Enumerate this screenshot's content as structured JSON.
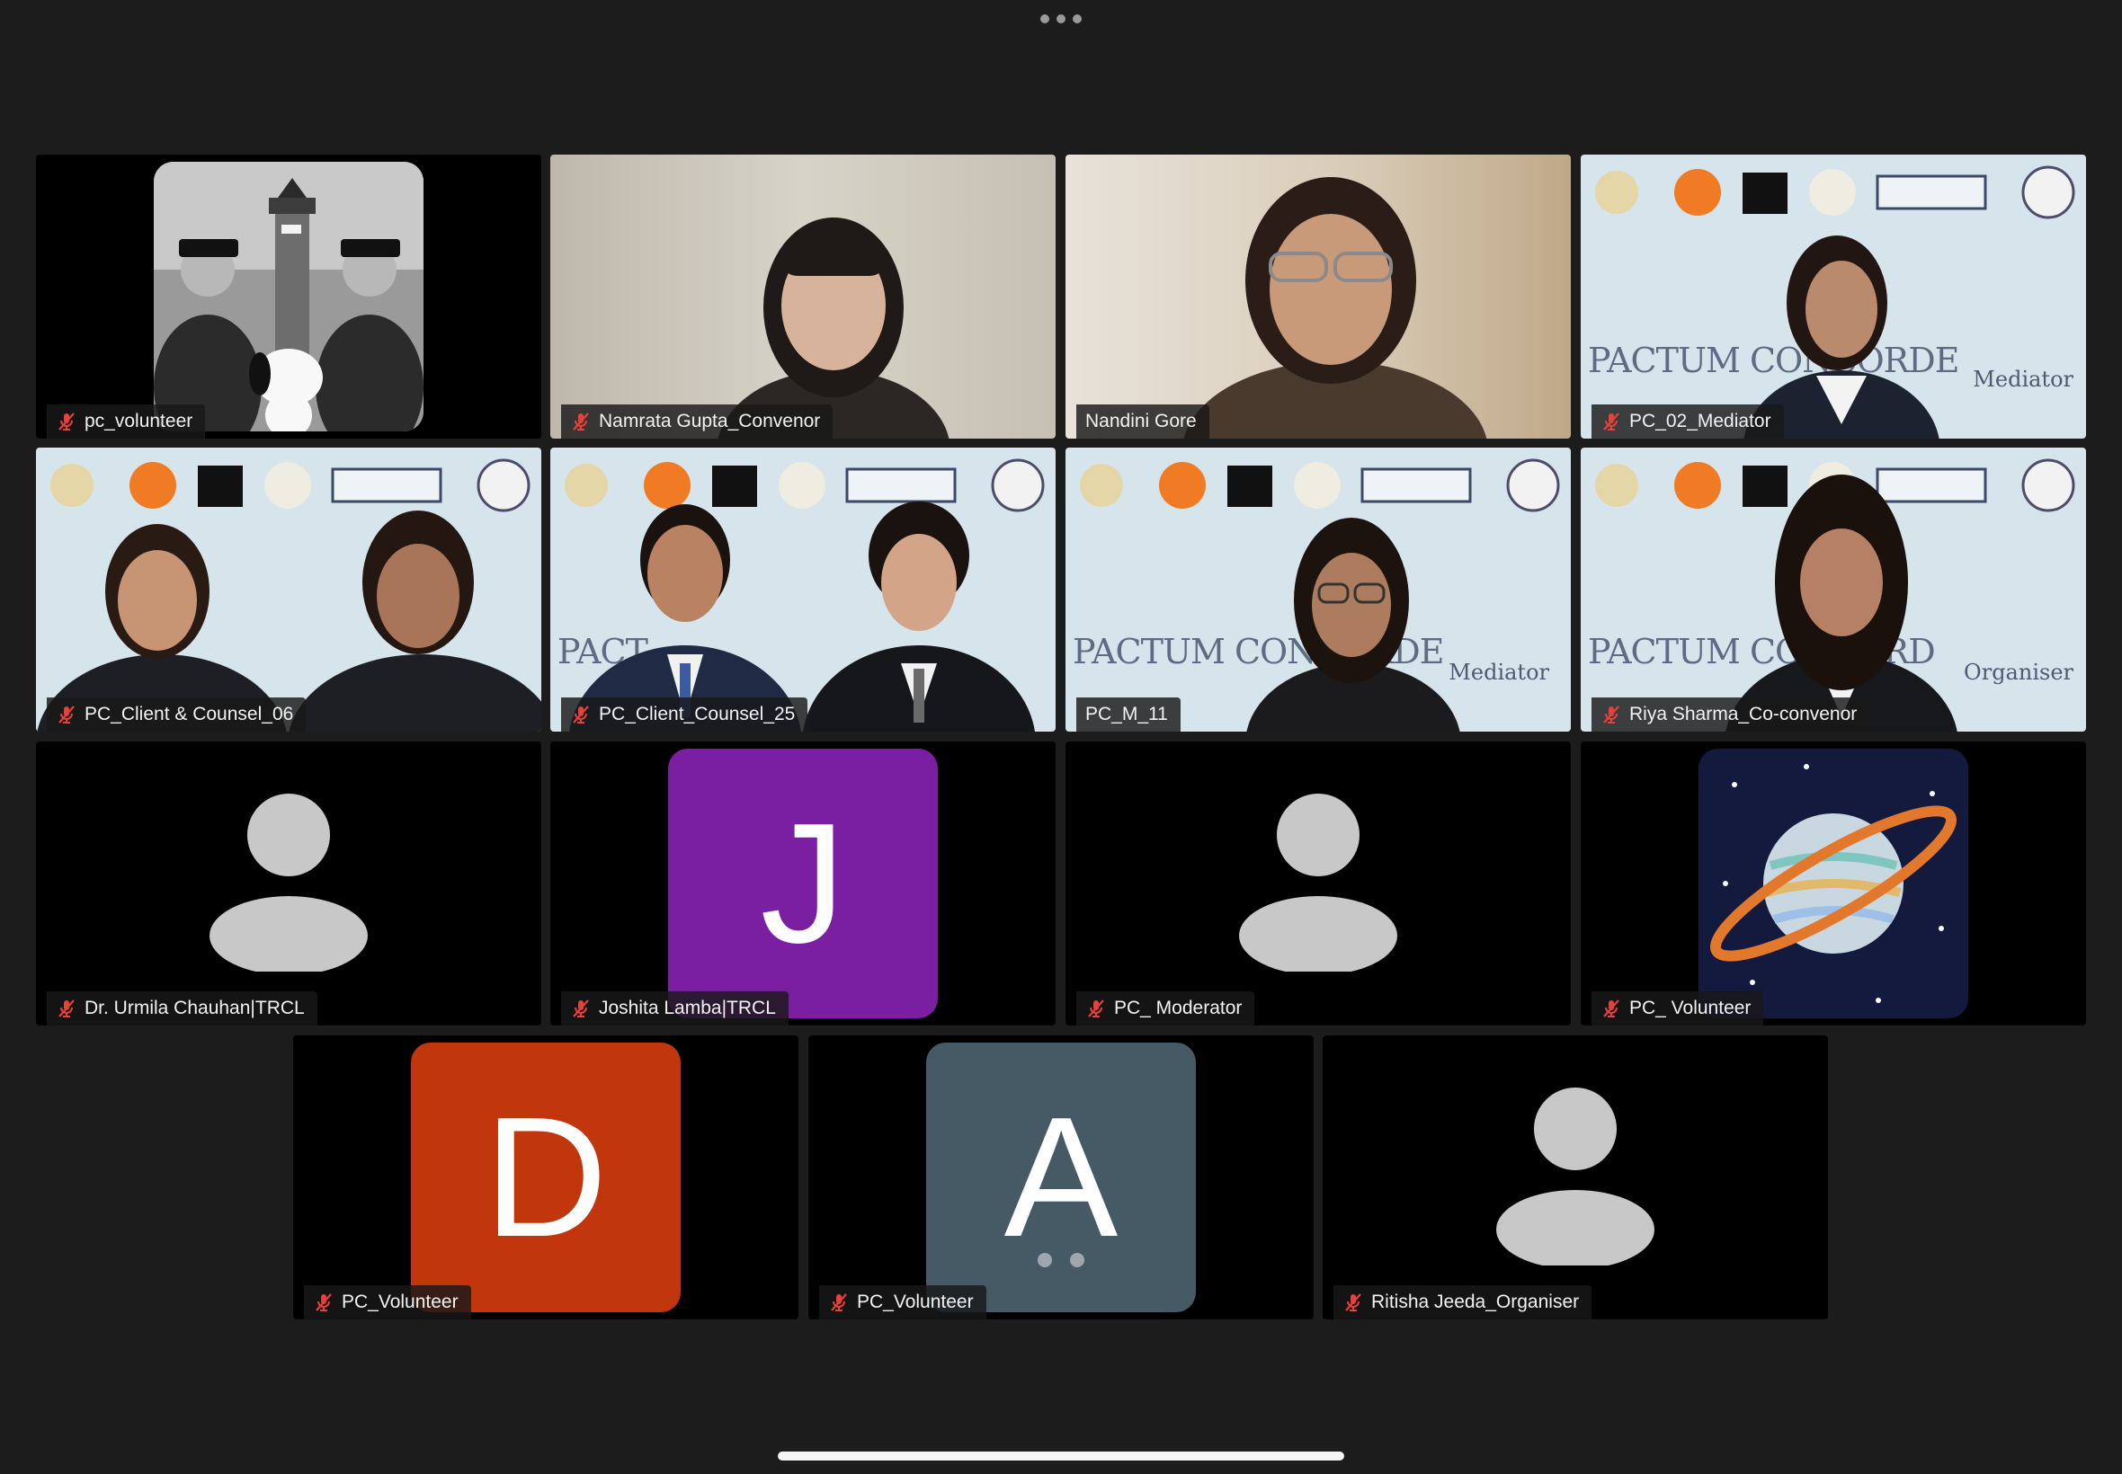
{
  "toolbar": {
    "more_icon": "more-horizontal-icon"
  },
  "participants": [
    {
      "name": "pc_volunteer",
      "muted": true,
      "kind": "photo-bw"
    },
    {
      "name": "Namrata Gupta_Convenor",
      "muted": true,
      "kind": "video"
    },
    {
      "name": "Nandini Gore",
      "muted": false,
      "kind": "video"
    },
    {
      "name": "PC_02_Mediator",
      "muted": true,
      "kind": "banner",
      "banner_title": "PACTUM CONCORDE",
      "banner_role": "Mediator"
    },
    {
      "name": "PC_Client & Counsel_06",
      "muted": true,
      "kind": "banner"
    },
    {
      "name": "PC_Client_Counsel_25",
      "muted": true,
      "kind": "banner",
      "banner_title": "PACT"
    },
    {
      "name": "PC_M_11",
      "muted": false,
      "active": true,
      "kind": "banner",
      "banner_title": "PACTUM CONCORDE",
      "banner_role": "Mediator"
    },
    {
      "name": "Riya Sharma_Co-convenor",
      "muted": true,
      "kind": "banner",
      "banner_title": "PACTUM CONCORD",
      "banner_role": "Organiser"
    },
    {
      "name": "Dr. Urmila Chauhan|TRCL",
      "muted": true,
      "kind": "silhouette"
    },
    {
      "name": "Joshita Lamba|TRCL",
      "muted": true,
      "kind": "initial",
      "initial": "J",
      "color": "#7a1fa2"
    },
    {
      "name": "PC_ Moderator",
      "muted": true,
      "kind": "silhouette"
    },
    {
      "name": "PC_ Volunteer",
      "muted": true,
      "kind": "planet"
    },
    {
      "name": "PC_Volunteer",
      "muted": true,
      "kind": "initial",
      "initial": "D",
      "color": "#c1360c"
    },
    {
      "name": "PC_Volunteer",
      "muted": true,
      "kind": "initial",
      "initial": "A",
      "color": "#455a64",
      "loading": true
    },
    {
      "name": "Ritisha Jeeda_Organiser",
      "muted": true,
      "kind": "silhouette"
    }
  ],
  "colors": {
    "background": "#1c1c1c",
    "active_border": "#23d160",
    "mute_icon": "#e8413a"
  }
}
